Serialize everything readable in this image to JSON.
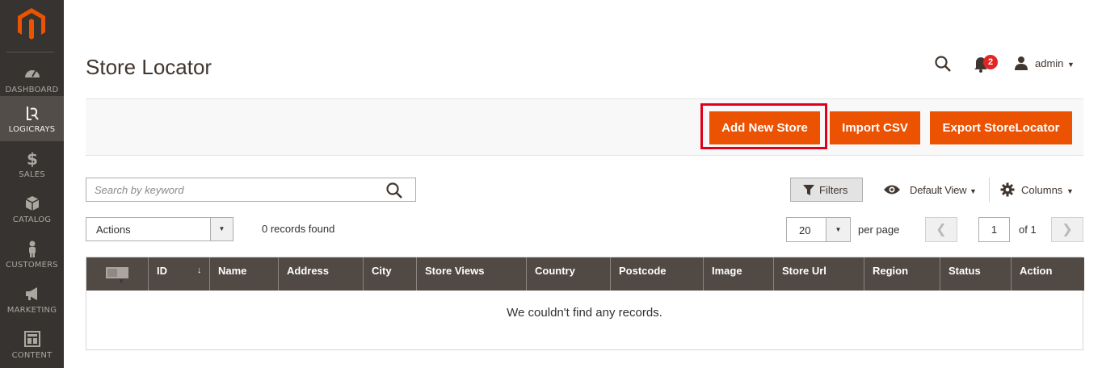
{
  "sidebar": {
    "logo_name": "magento-logo",
    "items": [
      {
        "label": "DASHBOARD",
        "icon": "dashboard-icon",
        "active": false
      },
      {
        "label": "LOGICRAYS",
        "icon": "logicrays-icon",
        "active": true
      },
      {
        "label": "SALES",
        "icon": "dollar-icon",
        "active": false
      },
      {
        "label": "CATALOG",
        "icon": "box-icon",
        "active": false
      },
      {
        "label": "CUSTOMERS",
        "icon": "person-icon",
        "active": false
      },
      {
        "label": "MARKETING",
        "icon": "megaphone-icon",
        "active": false
      },
      {
        "label": "CONTENT",
        "icon": "layout-icon",
        "active": false
      }
    ]
  },
  "header": {
    "title": "Store Locator",
    "notifications_count": "2",
    "user": "admin"
  },
  "toolbar": {
    "add_new_store": "Add New Store",
    "import_csv": "Import CSV",
    "export": "Export StoreLocator"
  },
  "grid_controls": {
    "search_placeholder": "Search by keyword",
    "filters": "Filters",
    "view": "Default View",
    "columns": "Columns",
    "actions": "Actions",
    "records_found": "0 records found",
    "per_page_value": "20",
    "per_page_label": "per page",
    "current_page": "1",
    "of_pages": "of 1"
  },
  "table": {
    "columns": [
      "ID",
      "Name",
      "Address",
      "City",
      "Store Views",
      "Country",
      "Postcode",
      "Image",
      "Store Url",
      "Region",
      "Status",
      "Action"
    ],
    "empty_message": "We couldn't find any records."
  },
  "colors": {
    "sidebar_bg": "#373330",
    "accent": "#eb5202",
    "header_row": "#514943",
    "highlight": "#e0001b"
  }
}
